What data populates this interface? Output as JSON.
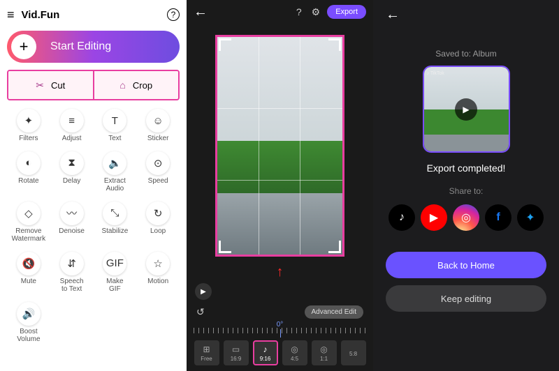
{
  "left": {
    "app_title": "Vid.Fun",
    "start_label": "Start Editing",
    "cut_label": "Cut",
    "crop_label": "Crop",
    "tools": [
      "Filters",
      "Adjust",
      "Text",
      "Sticker",
      "Rotate",
      "Delay",
      "Extract Audio",
      "Speed",
      "Remove Watermark",
      "Denoise",
      "Stabilize",
      "Loop",
      "Mute",
      "Speech to Text",
      "Make GIF",
      "Motion",
      "Boost Volume"
    ]
  },
  "mid": {
    "export_label": "Export",
    "advanced_label": "Advanced Edit",
    "ruler_center": "0°",
    "aspects": [
      {
        "label": "Free",
        "icon": "⊞"
      },
      {
        "label": "16:9",
        "icon": "▭"
      },
      {
        "label": "9:16",
        "icon": "♪",
        "selected": true
      },
      {
        "label": "4:5",
        "icon": "◎"
      },
      {
        "label": "1:1",
        "icon": "◎"
      },
      {
        "label": "5:8",
        "icon": ""
      }
    ]
  },
  "right": {
    "saved_to": "Saved to: Album",
    "completed": "Export completed!",
    "share_to": "Share to:",
    "back_home": "Back to Home",
    "keep_editing": "Keep editing",
    "socials": [
      "tiktok",
      "youtube",
      "instagram",
      "facebook",
      "twitter"
    ]
  }
}
